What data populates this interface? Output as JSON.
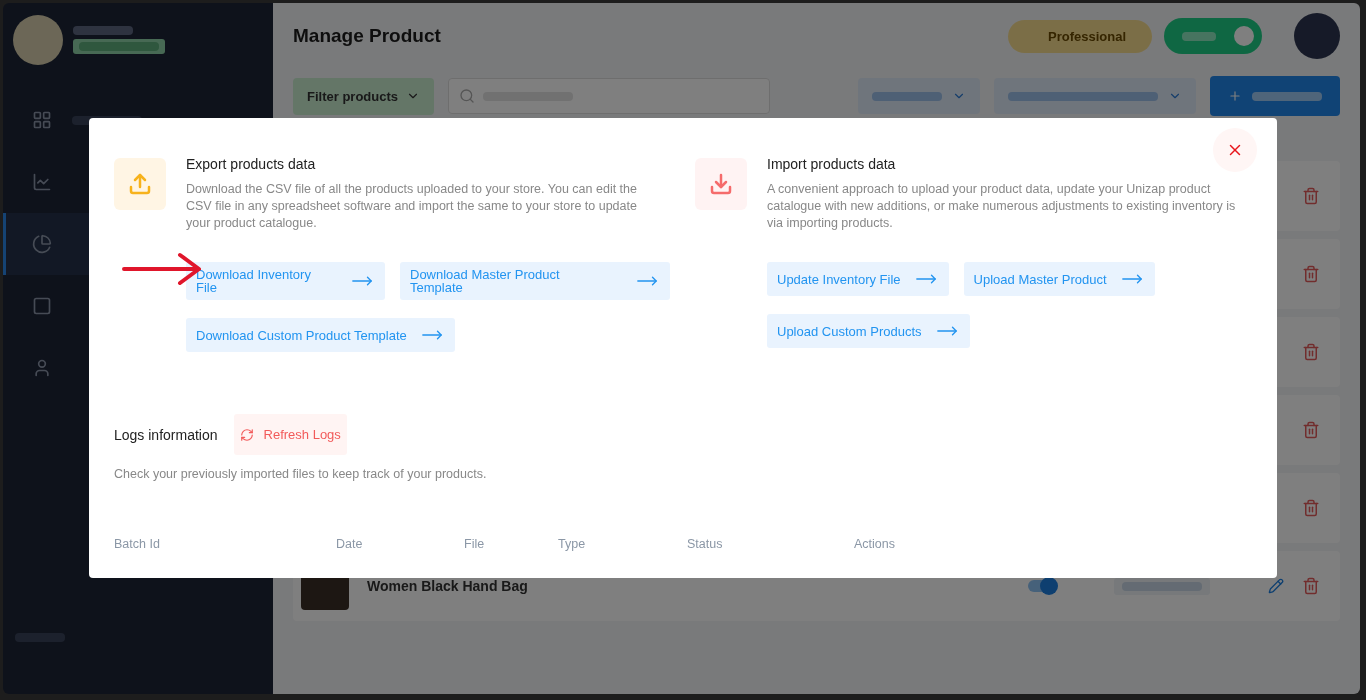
{
  "sidebar": {
    "items": [
      {
        "kind": "grid",
        "selected": false
      },
      {
        "kind": "chart",
        "selected": false
      },
      {
        "kind": "catalog",
        "selected": true
      },
      {
        "kind": "frame",
        "selected": false
      },
      {
        "kind": "person",
        "selected": false
      }
    ]
  },
  "header": {
    "title": "Manage Product",
    "plan": "Professional",
    "online": {
      "on": true
    }
  },
  "toolbar": {
    "filter": "Filter products"
  },
  "product_rows": [
    {
      "kind": "covered"
    },
    {
      "kind": "covered"
    },
    {
      "kind": "covered"
    },
    {
      "kind": "covered"
    },
    {
      "kind": "covered"
    },
    {
      "kind": "full",
      "name": "Women Black Hand Bag",
      "enabled": true
    }
  ],
  "modal": {
    "sections": [
      {
        "kind": "export",
        "title": "Export products data",
        "description": "Download the CSV file of all the products uploaded to your store. You can edit the CSV file in any spreadsheet software and import the same to your store to update your product catalogue.",
        "buttons": [
          "Download Inventory File",
          "Download Master Product Template",
          "Download Custom Product Template"
        ]
      },
      {
        "kind": "import",
        "title": "Import products data",
        "description": "A convenient approach to upload your product data, update your Unizap product catalogue with new additions, or make numerous adjustments to existing inventory is via importing products.",
        "buttons": [
          "Update Inventory File",
          "Upload Master Product",
          "Upload Custom Products"
        ]
      }
    ],
    "logs": {
      "title": "Logs information",
      "refresh": "Refresh Logs",
      "description": "Check your previously imported files to keep track of your products.",
      "columns": [
        "Batch Id",
        "Date",
        "File",
        "Type",
        "Status",
        "Actions"
      ]
    }
  }
}
